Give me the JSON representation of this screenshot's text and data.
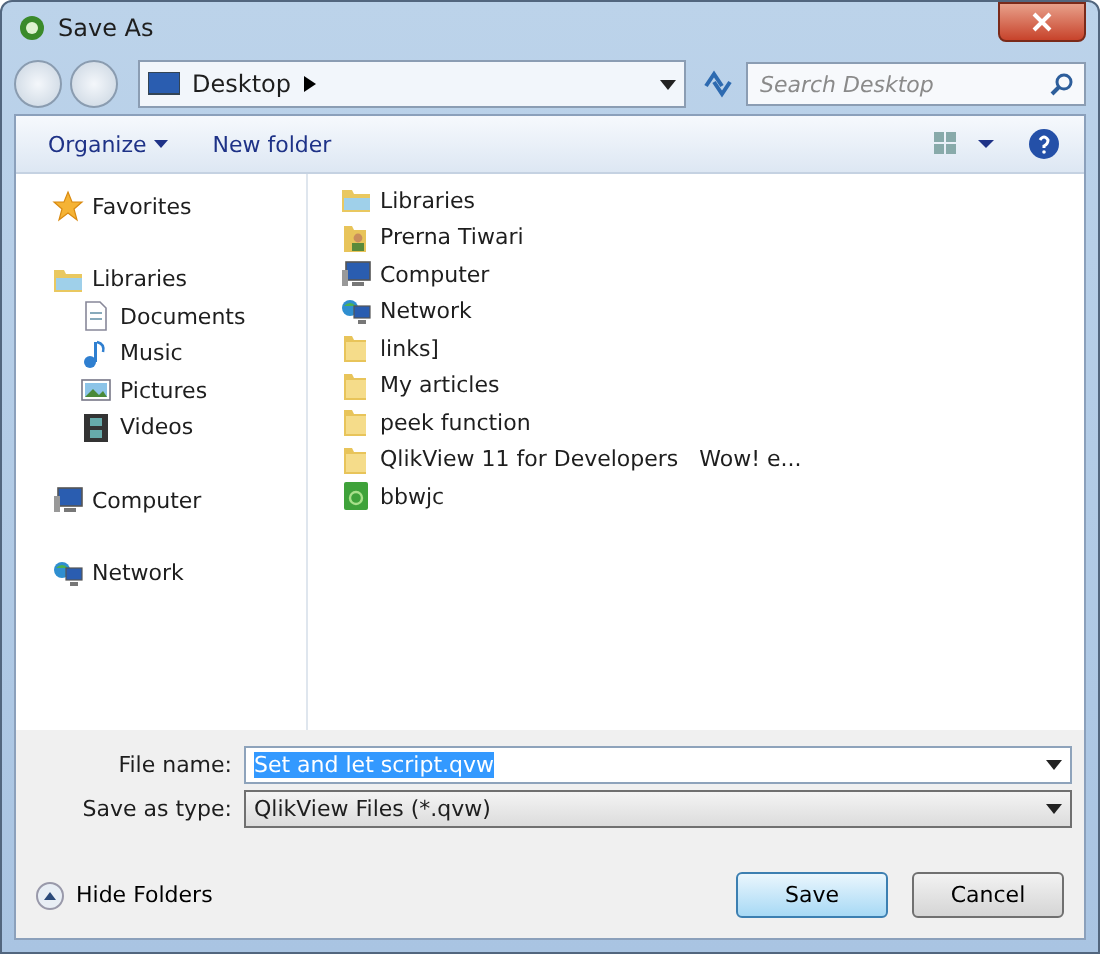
{
  "window": {
    "title": "Save As"
  },
  "address": {
    "location": "Desktop"
  },
  "search": {
    "placeholder": "Search Desktop"
  },
  "toolbar": {
    "organize": "Organize",
    "new_folder": "New folder"
  },
  "sidebar": {
    "groups": [
      {
        "label": "Favorites",
        "kind": "star"
      },
      {
        "label": "Libraries",
        "kind": "library",
        "children": [
          {
            "label": "Documents",
            "kind": "document"
          },
          {
            "label": "Music",
            "kind": "music"
          },
          {
            "label": "Pictures",
            "kind": "picture"
          },
          {
            "label": "Videos",
            "kind": "video"
          }
        ]
      },
      {
        "label": "Computer",
        "kind": "computer"
      },
      {
        "label": "Network",
        "kind": "network"
      }
    ]
  },
  "files": [
    {
      "name": "Libraries",
      "kind": "library"
    },
    {
      "name": "Prerna Tiwari",
      "kind": "user"
    },
    {
      "name": "Computer",
      "kind": "computer"
    },
    {
      "name": "Network",
      "kind": "network"
    },
    {
      "name": "links]",
      "kind": "folder"
    },
    {
      "name": "My articles",
      "kind": "folder"
    },
    {
      "name": "peek function",
      "kind": "folder"
    },
    {
      "name": "QlikView 11 for Developers   Wow! e...",
      "kind": "folder"
    },
    {
      "name": "bbwjc",
      "kind": "app"
    }
  ],
  "form": {
    "file_name_label": "File name:",
    "file_name": "Set and let script.qvw",
    "file_name_highlighted": true,
    "type_label": "Save as type:",
    "type": "QlikView Files (*.qvw)"
  },
  "footer": {
    "hide_folders": "Hide Folders",
    "save": "Save",
    "cancel": "Cancel"
  }
}
